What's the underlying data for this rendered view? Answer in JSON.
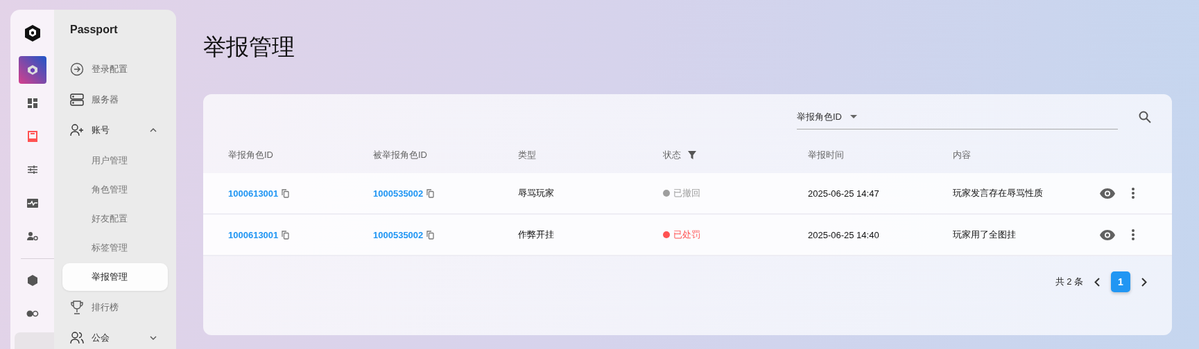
{
  "rail": [
    {
      "selected": false
    },
    {
      "selected": true
    },
    {
      "selected": false
    },
    {
      "selected": false
    },
    {
      "selected": false
    },
    {
      "selected": false
    },
    {
      "selected": false
    }
  ],
  "sidebar": {
    "title": "Passport",
    "items": [
      {
        "label": "登录配置"
      },
      {
        "label": "服务器"
      },
      {
        "label": "账号",
        "expanded": true,
        "children": [
          {
            "label": "用户管理",
            "selected": false
          },
          {
            "label": "角色管理",
            "selected": false
          },
          {
            "label": "好友配置",
            "selected": false
          },
          {
            "label": "标签管理",
            "selected": false
          },
          {
            "label": "举报管理",
            "selected": true
          }
        ]
      },
      {
        "label": "排行榜"
      },
      {
        "label": "公会",
        "expanded": false
      }
    ]
  },
  "page_title": "举报管理",
  "search": {
    "filter": "举报角色ID"
  },
  "table": {
    "columns": [
      {
        "label": "举报角色ID"
      },
      {
        "label": "被举报角色ID"
      },
      {
        "label": "类型"
      },
      {
        "label": "状态",
        "filter": true
      },
      {
        "label": "举报时间"
      },
      {
        "label": "内容"
      }
    ],
    "rows": [
      {
        "reporter": "1000613001",
        "reported": "1000535002",
        "type": "辱骂玩家",
        "status": {
          "text": "已撤回",
          "color": "#9e9e9e"
        },
        "time": "2025-06-25 14:47",
        "content": "玩家发言存在辱骂性质"
      },
      {
        "reporter": "1000613001",
        "reported": "1000535002",
        "type": "作弊开挂",
        "status": {
          "text": "已处罚",
          "color": "#ff5252"
        },
        "time": "2025-06-25 14:40",
        "content": "玩家用了全图挂"
      }
    ]
  },
  "pagination": {
    "total": "共 2 条",
    "pages": [
      {
        "label": "1",
        "selected": true
      }
    ]
  }
}
